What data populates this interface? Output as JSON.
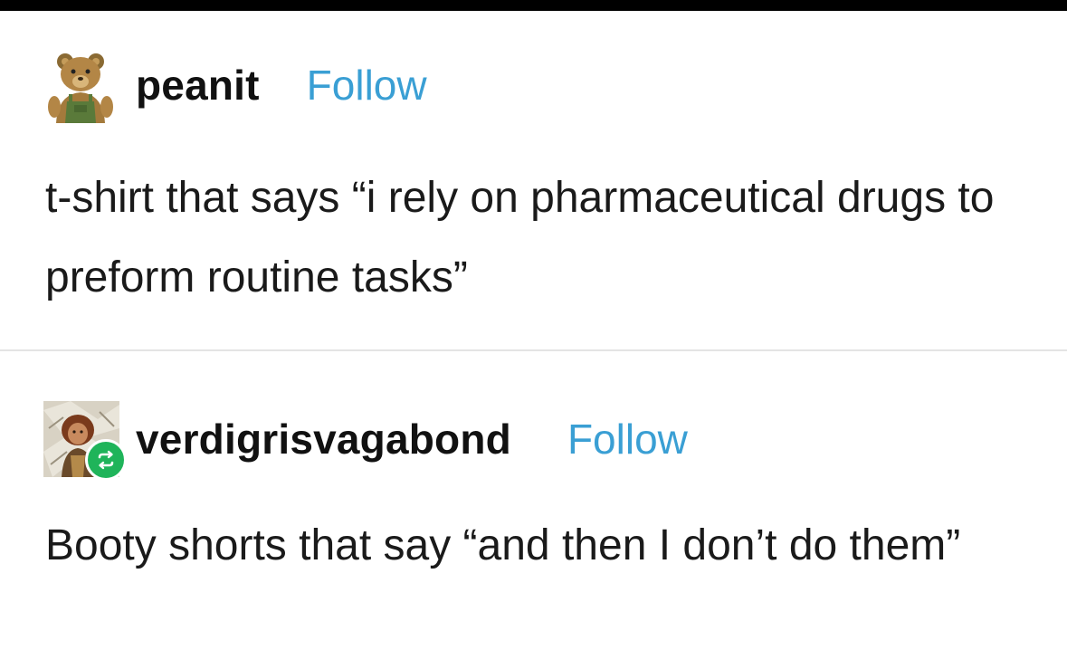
{
  "posts": [
    {
      "username": "peanit",
      "follow_label": "Follow",
      "text": "t-shirt that says “i rely on pharmaceutical drugs to preform routine tasks”",
      "avatar": "teddy-bear-avatar"
    },
    {
      "username": "verdigrisvagabond",
      "follow_label": "Follow",
      "text": "Booty shorts that say “and then I don’t do them”",
      "avatar": "illustrated-character-avatar",
      "badge": "reblog-icon"
    }
  ],
  "colors": {
    "follow": "#3a9fd4",
    "reblog_badge": "#1fb45a",
    "top_bar": "#000000",
    "divider": "#e4e4e4"
  }
}
